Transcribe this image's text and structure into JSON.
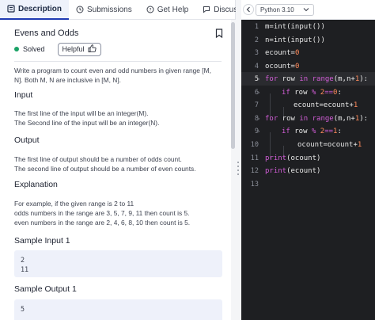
{
  "tabs": {
    "description": "Description",
    "submissions": "Submissions",
    "get_help": "Get Help",
    "discuss": "Discuss"
  },
  "problem": {
    "title": "Evens and Odds",
    "status": "Solved",
    "helpful_label": "Helpful",
    "statement_line1": "Write a program to count even and odd numbers in given range [M,",
    "statement_line2": "N]. Both M, N are inclusive in [M, N].",
    "input_heading": "Input",
    "input_line1": "The first line of the input will be an integer(M).",
    "input_line2": "The Second line of the input will be an integer(N).",
    "output_heading": "Output",
    "output_line1": "The first line of output should be a number of odds count.",
    "output_line2": "The second line of output should be a number of even counts.",
    "explanation_heading": "Explanation",
    "explanation_line1": "For example, if the given range is 2 to 11",
    "explanation_line2": "odds numbers in the range are 3, 5, 7, 9, 11 then count is 5.",
    "explanation_line3": "even numbers in the range are 2, 4, 6, 8, 10 then count is 5.",
    "sample_input_heading": "Sample Input 1",
    "sample_input_line1": "2",
    "sample_input_line2": "11",
    "sample_output_heading": "Sample Output 1",
    "sample_output_line1": "5"
  },
  "editor": {
    "language": "Python 3.10",
    "lines": [
      {
        "n": "1"
      },
      {
        "n": "2"
      },
      {
        "n": "3"
      },
      {
        "n": "4"
      },
      {
        "n": "5"
      },
      {
        "n": "6"
      },
      {
        "n": "7"
      },
      {
        "n": "8"
      },
      {
        "n": "9"
      },
      {
        "n": "10"
      },
      {
        "n": "11"
      },
      {
        "n": "12"
      },
      {
        "n": "13"
      }
    ],
    "tokens": {
      "l1_a": "m=int(input())",
      "l2_a": "n=int(input())",
      "l3_a": "ecount=",
      "l3_b": "0",
      "l4_a": "ocount=",
      "l4_b": "0",
      "l5_kw1": "for",
      "l5_a": " row ",
      "l5_kw2": "in",
      "l5_b": " ",
      "l5_fn": "range",
      "l5_c": "(m,n+",
      "l5_num": "1",
      "l5_d": "):",
      "l6_kw": "if",
      "l6_a": " row ",
      "l6_op": "%",
      "l6_b": " ",
      "l6_num1": "2",
      "l6_c": "==",
      "l6_num2": "0",
      "l6_d": ":",
      "l7_a": "ecount=ecount+",
      "l7_num": "1",
      "l8_kw1": "for",
      "l8_a": " row ",
      "l8_kw2": "in",
      "l8_b": " ",
      "l8_fn": "range",
      "l8_c": "(m,n+",
      "l8_num": "1",
      "l8_d": "):",
      "l9_kw": "if",
      "l9_a": " row ",
      "l9_op": "%",
      "l9_b": " ",
      "l9_num1": "2",
      "l9_c": "==",
      "l9_num2": "1",
      "l9_d": ":",
      "l10_a": "ocount=ocount+",
      "l10_num": "1",
      "l11_kw": "print",
      "l11_a": "(ocount)",
      "l12_kw": "print",
      "l12_a": "(ecount)"
    }
  },
  "colors": {
    "accent": "#1f3bb3",
    "solved": "#1aa266",
    "editor_bg": "#1e1f22",
    "keyword": "#d15dd6",
    "number": "#ff8b5c"
  }
}
